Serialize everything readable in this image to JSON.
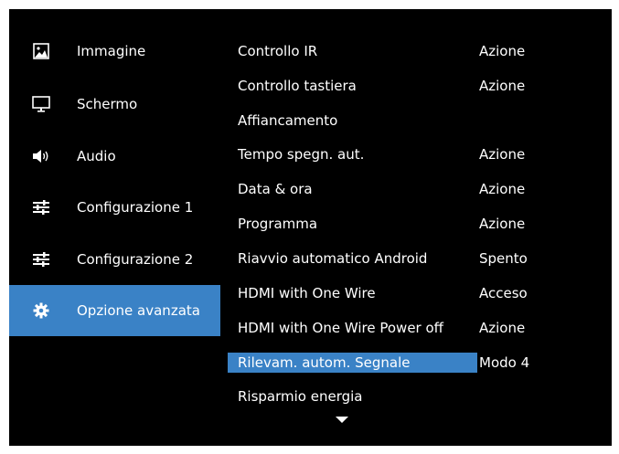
{
  "sidebar": {
    "items": [
      {
        "label": "Immagine",
        "icon": "picture-icon"
      },
      {
        "label": "Schermo",
        "icon": "monitor-icon"
      },
      {
        "label": "Audio",
        "icon": "speaker-icon"
      },
      {
        "label": "Configurazione 1",
        "icon": "sliders-icon"
      },
      {
        "label": "Configurazione 2",
        "icon": "sliders-icon"
      },
      {
        "label": "Opzione avanzata",
        "icon": "gear-icon",
        "selected": true
      }
    ]
  },
  "menu": {
    "rows": [
      {
        "label": "Controllo IR",
        "value": "Azione"
      },
      {
        "label": "Controllo tastiera",
        "value": "Azione"
      },
      {
        "label": "Affiancamento",
        "value": ""
      },
      {
        "label": "Tempo spegn. aut.",
        "value": "Azione"
      },
      {
        "label": "Data & ora",
        "value": "Azione"
      },
      {
        "label": "Programma",
        "value": "Azione"
      },
      {
        "label": "Riavvio automatico Android",
        "value": "Spento"
      },
      {
        "label": "HDMI with One Wire",
        "value": "Acceso"
      },
      {
        "label": "HDMI with One Wire Power off",
        "value": "Azione"
      },
      {
        "label": "Rilevam. autom. Segnale",
        "value": "Modo 4",
        "selected": true
      },
      {
        "label": "Risparmio energia",
        "value": ""
      }
    ],
    "more_indicator": "chevron-down-icon"
  },
  "colors": {
    "background": "#000000",
    "highlight": "#3a82c6",
    "text": "#ffffff"
  }
}
